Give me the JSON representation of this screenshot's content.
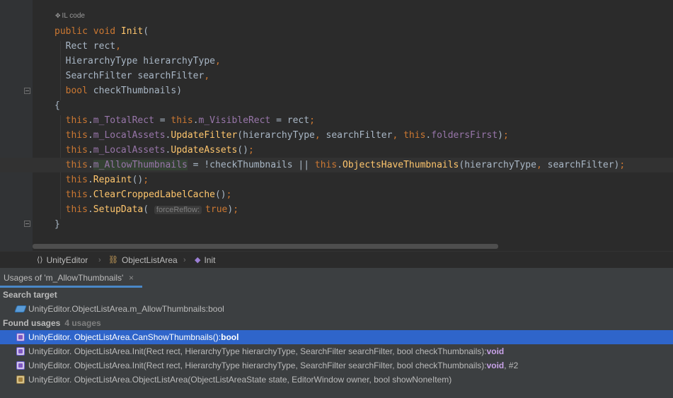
{
  "editor": {
    "il_hint": "IL code",
    "lines": [
      [
        {
          "t": "public void ",
          "c": "k"
        },
        {
          "t": "Init",
          "c": "fn"
        },
        {
          "t": "(",
          "c": "t"
        }
      ],
      [
        {
          "t": "  Rect rect",
          "c": "t"
        },
        {
          "t": ",",
          "c": "k"
        }
      ],
      [
        {
          "t": "  HierarchyType hierarchyType",
          "c": "t"
        },
        {
          "t": ",",
          "c": "k"
        }
      ],
      [
        {
          "t": "  SearchFilter searchFilter",
          "c": "t"
        },
        {
          "t": ",",
          "c": "k"
        }
      ],
      [
        {
          "t": "  ",
          "c": "t"
        },
        {
          "t": "bool ",
          "c": "k"
        },
        {
          "t": "checkThumbnails)",
          "c": "t"
        }
      ],
      [
        {
          "t": "{",
          "c": "t"
        }
      ],
      [
        {
          "t": "  ",
          "c": "t"
        },
        {
          "t": "this",
          "c": "k"
        },
        {
          "t": ".",
          "c": "t"
        },
        {
          "t": "m_TotalRect",
          "c": "f"
        },
        {
          "t": " = ",
          "c": "t"
        },
        {
          "t": "this",
          "c": "k"
        },
        {
          "t": ".",
          "c": "t"
        },
        {
          "t": "m_VisibleRect",
          "c": "f"
        },
        {
          "t": " = rect",
          "c": "t"
        },
        {
          "t": ";",
          "c": "k"
        }
      ],
      [
        {
          "t": "  ",
          "c": "t"
        },
        {
          "t": "this",
          "c": "k"
        },
        {
          "t": ".",
          "c": "t"
        },
        {
          "t": "m_LocalAssets",
          "c": "f"
        },
        {
          "t": ".",
          "c": "t"
        },
        {
          "t": "UpdateFilter",
          "c": "fn"
        },
        {
          "t": "(hierarchyType",
          "c": "t"
        },
        {
          "t": ", ",
          "c": "k"
        },
        {
          "t": "searchFilter",
          "c": "t"
        },
        {
          "t": ", ",
          "c": "k"
        },
        {
          "t": "this",
          "c": "k"
        },
        {
          "t": ".",
          "c": "t"
        },
        {
          "t": "foldersFirst",
          "c": "f"
        },
        {
          "t": ")",
          "c": "t"
        },
        {
          "t": ";",
          "c": "k"
        }
      ],
      [
        {
          "t": "  ",
          "c": "t"
        },
        {
          "t": "this",
          "c": "k"
        },
        {
          "t": ".",
          "c": "t"
        },
        {
          "t": "m_LocalAssets",
          "c": "f"
        },
        {
          "t": ".",
          "c": "t"
        },
        {
          "t": "UpdateAssets",
          "c": "fn"
        },
        {
          "t": "()",
          "c": "t"
        },
        {
          "t": ";",
          "c": "k"
        }
      ],
      [
        {
          "t": "  ",
          "c": "t"
        },
        {
          "t": "this",
          "c": "k"
        },
        {
          "t": ".",
          "c": "t"
        },
        {
          "t": "m_AllowThumbnails",
          "c": "f hl"
        },
        {
          "t": " = !checkThumbnails || ",
          "c": "t"
        },
        {
          "t": "this",
          "c": "k"
        },
        {
          "t": ".",
          "c": "t"
        },
        {
          "t": "ObjectsHaveThumbnails",
          "c": "fn"
        },
        {
          "t": "(hierarchyType",
          "c": "t"
        },
        {
          "t": ", ",
          "c": "k"
        },
        {
          "t": "searchFilter)",
          "c": "t"
        },
        {
          "t": ";",
          "c": "k"
        }
      ],
      [
        {
          "t": "  ",
          "c": "t"
        },
        {
          "t": "this",
          "c": "k"
        },
        {
          "t": ".",
          "c": "t"
        },
        {
          "t": "Repaint",
          "c": "fn"
        },
        {
          "t": "()",
          "c": "t"
        },
        {
          "t": ";",
          "c": "k"
        }
      ],
      [
        {
          "t": "  ",
          "c": "t"
        },
        {
          "t": "this",
          "c": "k"
        },
        {
          "t": ".",
          "c": "t"
        },
        {
          "t": "ClearCroppedLabelCache",
          "c": "fn"
        },
        {
          "t": "()",
          "c": "t"
        },
        {
          "t": ";",
          "c": "k"
        }
      ],
      [
        {
          "t": "  ",
          "c": "t"
        },
        {
          "t": "this",
          "c": "k"
        },
        {
          "t": ".",
          "c": "t"
        },
        {
          "t": "SetupData",
          "c": "fn"
        },
        {
          "t": "( ",
          "c": "t"
        },
        {
          "t": "forceReflow:",
          "c": "hint"
        },
        {
          "t": "true",
          "c": "k"
        },
        {
          "t": ")",
          "c": "t"
        },
        {
          "t": ";",
          "c": "k"
        }
      ],
      [
        {
          "t": "}",
          "c": "t"
        }
      ]
    ]
  },
  "breadcrumb": {
    "items": [
      "UnityEditor",
      "ObjectListArea",
      "Init"
    ]
  },
  "usages_tab": {
    "label": "Usages of 'm_AllowThumbnails'",
    "close_glyph": "×"
  },
  "results": {
    "search_target_label": "Search target",
    "target": "UnityEditor.ObjectListArea.m_AllowThumbnails:bool",
    "found_label": "Found usages",
    "found_count": "4 usages",
    "usages": [
      {
        "text": "UnityEditor. ObjectListArea.CanShowThumbnails():",
        "ret": "bool",
        "suffix": "",
        "icon": "method-icon",
        "selected": true
      },
      {
        "text": "UnityEditor. ObjectListArea.Init(Rect rect, HierarchyType hierarchyType, SearchFilter searchFilter, bool checkThumbnails):",
        "ret": "void",
        "suffix": "",
        "icon": "method-icon",
        "selected": false
      },
      {
        "text": "UnityEditor. ObjectListArea.Init(Rect rect, HierarchyType hierarchyType, SearchFilter searchFilter, bool checkThumbnails):",
        "ret": "void",
        "suffix": ", #2",
        "icon": "method-icon",
        "selected": false
      },
      {
        "text": "UnityEditor. ObjectListArea.ObjectListArea(ObjectListAreaState state, EditorWindow owner, bool showNoneItem)",
        "ret": "",
        "suffix": "",
        "icon": "constructor-icon",
        "selected": false
      }
    ]
  },
  "colors": {
    "editor_bg": "#2b2b2b",
    "keyword": "#cc7832",
    "field": "#9876aa",
    "method": "#ffc66d",
    "text": "#a9b7c6",
    "selection": "#2f65ca",
    "tab_underline": "#4a88c7"
  }
}
